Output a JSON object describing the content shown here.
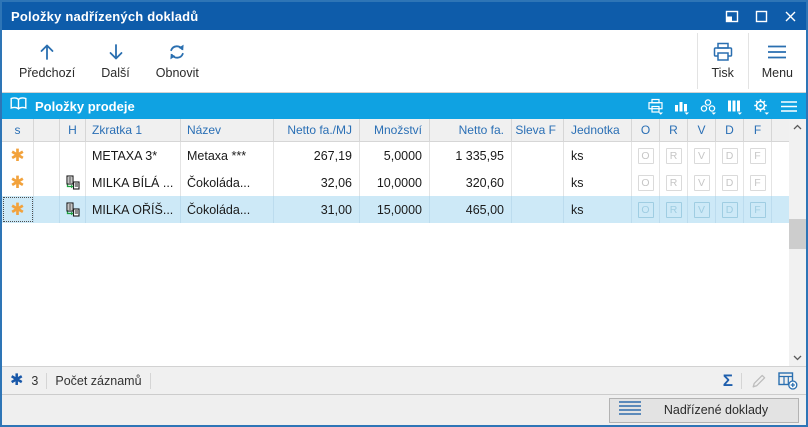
{
  "window": {
    "title": "Položky nadřízených dokladů"
  },
  "toolbar": {
    "prev": "Předchozí",
    "next": "Další",
    "refresh": "Obnovit",
    "print": "Tisk",
    "menu": "Menu"
  },
  "panel": {
    "title": "Položky prodeje"
  },
  "table": {
    "columns": [
      "s",
      "",
      "H",
      "Zkratka 1",
      "Název",
      "Netto fa./MJ",
      "Množství",
      "Netto fa.",
      "Sleva F",
      "Jednotka",
      "O",
      "R",
      "V",
      "D",
      "F"
    ],
    "flag_letters": [
      "O",
      "R",
      "V",
      "D",
      "F"
    ],
    "rows": [
      {
        "zkratka": "METAXA 3*",
        "nazev": "Metaxa ***",
        "netto_mj": "267,19",
        "mnozstvi": "5,0000",
        "netto_fa": "1 335,95",
        "sleva_f": "",
        "jednotka": "ks"
      },
      {
        "zkratka": "MILKA BÍLÁ ...",
        "nazev": "Čokoláda...",
        "netto_mj": "32,06",
        "mnozstvi": "10,0000",
        "netto_fa": "320,60",
        "sleva_f": "",
        "jednotka": "ks"
      },
      {
        "zkratka": "MILKA OŘÍŠ...",
        "nazev": "Čokoláda...",
        "netto_mj": "31,00",
        "mnozstvi": "15,0000",
        "netto_fa": "465,00",
        "sleva_f": "",
        "jednotka": "ks"
      }
    ]
  },
  "statusbar": {
    "count": "3",
    "count_label": "Počet záznamů",
    "sum_symbol": "Σ"
  },
  "bottombar": {
    "tab_label": "Nadřízené doklady"
  },
  "colors": {
    "titlebar_blue": "#0e5caa",
    "panel_cyan": "#0fa2e2",
    "selection_blue": "#cde9f7",
    "icon_blue": "#2a6fb0",
    "header_text_blue": "#2a6fb5",
    "asterisk_orange": "#f2a23c",
    "asterisk_blue": "#1857a8"
  }
}
